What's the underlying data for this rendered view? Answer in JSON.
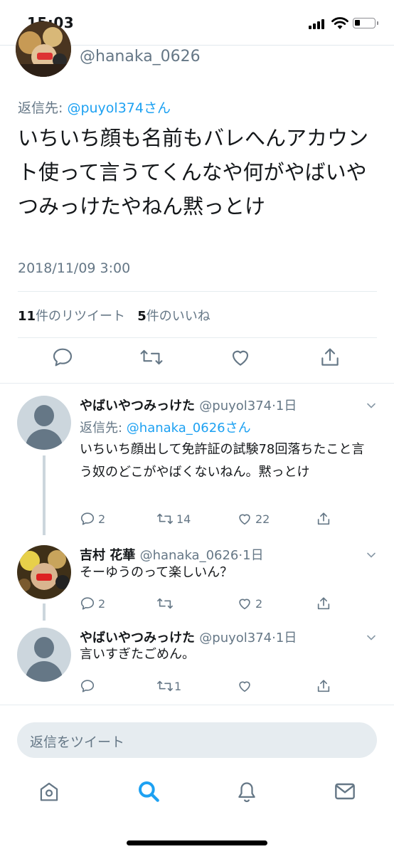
{
  "status": {
    "time": "15:03"
  },
  "main_tweet": {
    "handle": "@hanaka_0626",
    "reply_prefix": "返信先: ",
    "reply_to": "@puyol374さん",
    "text": "いちいち顔も名前もバレへんアカウント使って言うてくんなや何がやばいやつみっけたやねん黙っとけ",
    "time": "2018/11/09 3:00",
    "retweets_count": "11",
    "retweets_label": "件のリツイート",
    "likes_count": "5",
    "likes_label": "件のいいね"
  },
  "replies": [
    {
      "name": "やばいやつみっけた",
      "handle": "@puyol374",
      "time": "·1日",
      "reply_prefix": "返信先: ",
      "reply_to": "@hanaka_0626さん",
      "text": "いちいち顔出して免許証の試験78回落ちたこと言う奴のどこがやばくないねん。黙っとけ",
      "replies": "2",
      "retweets": "14",
      "likes": "22"
    },
    {
      "name": "吉村 花華",
      "handle": "@hanaka_0626",
      "time": "·1日",
      "text": "そーゆうのって楽しいん？",
      "replies": "2",
      "retweets": "",
      "likes": "2"
    },
    {
      "name": "やばいやつみっけた",
      "handle": "@puyol374",
      "time": "·1日",
      "text": "言いすぎたごめん。",
      "replies": "",
      "retweets": "1",
      "likes": ""
    }
  ],
  "compose": {
    "placeholder": "返信をツイート"
  },
  "colors": {
    "accent": "#1da1f2",
    "secondary": "#657786",
    "divider": "#e6ecf0"
  },
  "tabs": [
    {
      "icon": "home-icon",
      "active": false
    },
    {
      "icon": "search-icon",
      "active": true
    },
    {
      "icon": "notifications-icon",
      "active": false
    },
    {
      "icon": "messages-icon",
      "active": false
    }
  ]
}
